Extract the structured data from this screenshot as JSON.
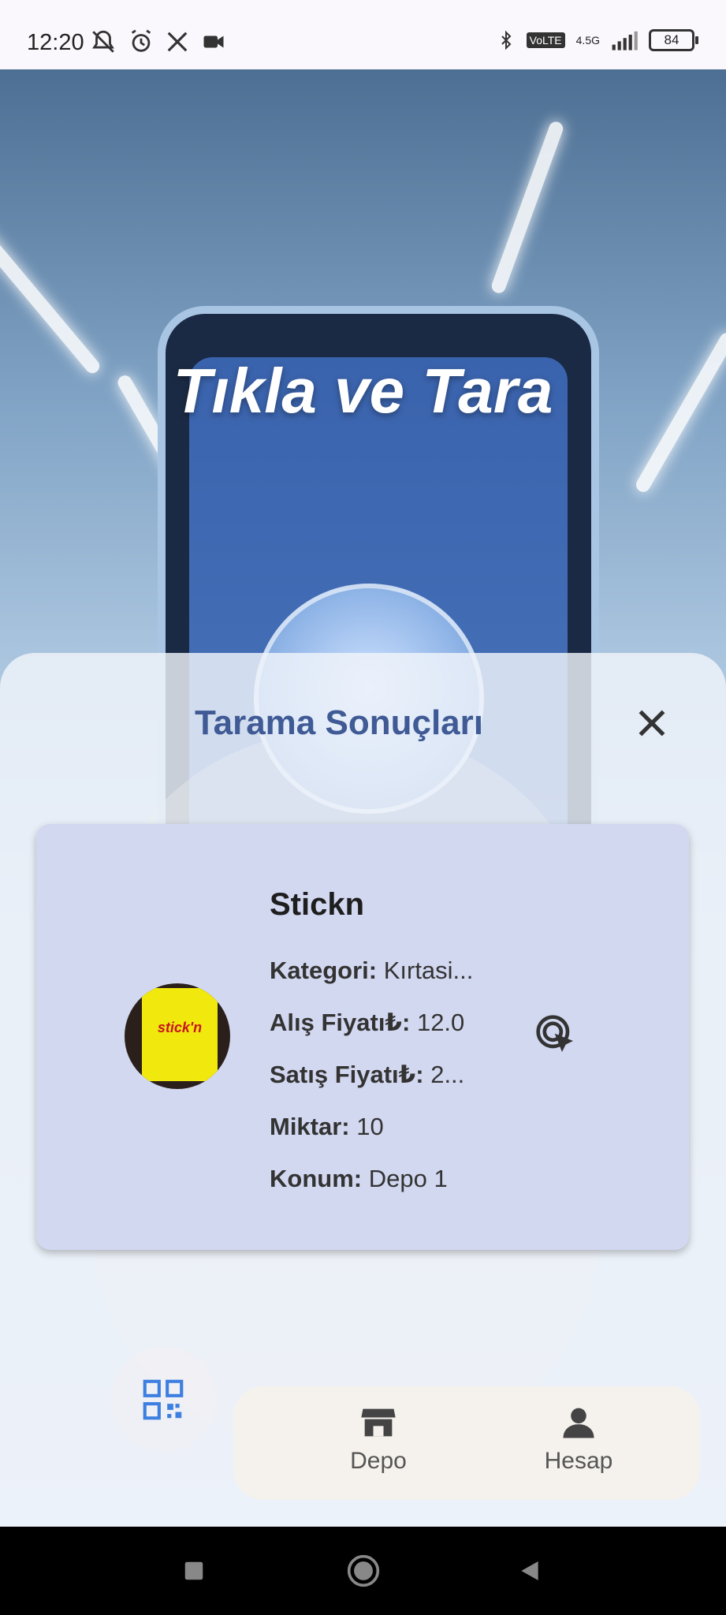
{
  "status_bar": {
    "time": "12:20",
    "battery": "84",
    "network": "4.5G"
  },
  "hero": {
    "title": "Tıkla ve Tara"
  },
  "sheet": {
    "title": "Tarama Sonuçları"
  },
  "result": {
    "name": "Stickn",
    "thumb_text": "stick'n",
    "fields": [
      {
        "label": "Kategori:",
        "value": "Kırtasi..."
      },
      {
        "label": "Alış Fiyatı₺:",
        "value": "12.0"
      },
      {
        "label": "Satış Fiyatı₺:",
        "value": "2..."
      },
      {
        "label": "Miktar:",
        "value": "10"
      },
      {
        "label": "Konum:",
        "value": "Depo 1"
      }
    ]
  },
  "bottom_nav": {
    "items": [
      {
        "label": "Depo"
      },
      {
        "label": "Hesap"
      }
    ]
  },
  "colors": {
    "accent": "#3f5a95",
    "card": "#d3d8f1",
    "qr": "#3d7fe0"
  }
}
